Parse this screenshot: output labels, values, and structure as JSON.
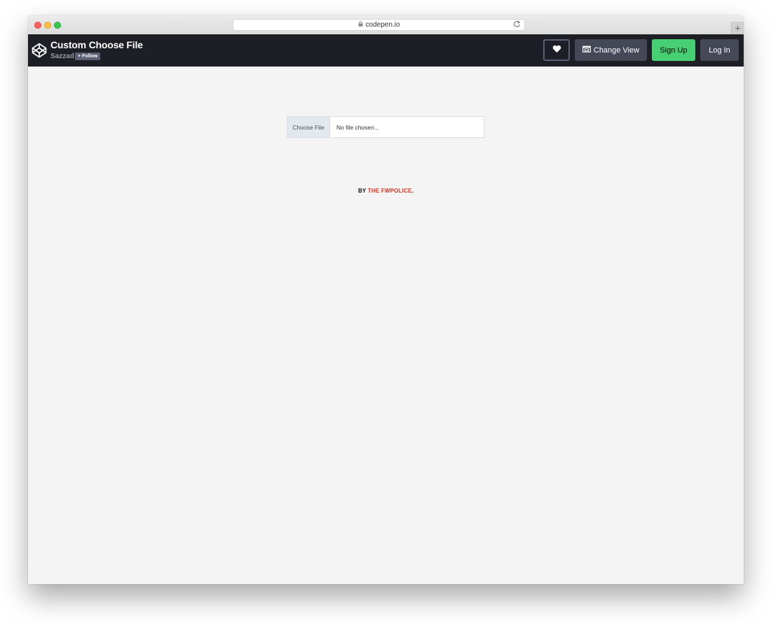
{
  "browser": {
    "url": "codepen.io"
  },
  "header": {
    "pen_title": "Custom Choose File",
    "author": "Sazzad",
    "follow_label": "+ Follow",
    "change_view_label": "Change View",
    "signup_label": "Sign Up",
    "login_label": "Log In"
  },
  "preview": {
    "choose_file_label": "Choose File",
    "file_status": "No file chosen...",
    "credit_prefix": "BY",
    "credit_link": "THE FWPOLICE",
    "credit_suffix": "."
  },
  "colors": {
    "header_bg": "#1e1f26",
    "signup_bg": "#47cf73",
    "button_bg": "#444857",
    "credit_link": "#e0301e"
  },
  "icons": [
    "codepen-logo-icon",
    "lock-icon",
    "reload-icon",
    "new-tab-icon",
    "heart-icon",
    "change-view-icon"
  ]
}
